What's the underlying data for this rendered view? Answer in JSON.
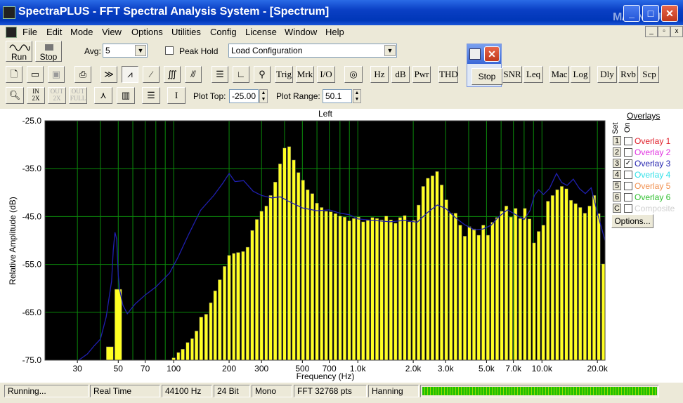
{
  "window": {
    "title": "SpectraPLUS - FFT Spectral Analysis System - [Spectrum]",
    "watermark": "MAGNITUDE"
  },
  "menu": [
    "File",
    "Edit",
    "Mode",
    "View",
    "Options",
    "Utilities",
    "Config",
    "License",
    "Window",
    "Help"
  ],
  "toolbar1": {
    "run_label": "Run",
    "stop_label": "Stop",
    "avg_label": "Avg:",
    "avg_value": "5",
    "peak_hold_label": "Peak Hold",
    "config_value": "Load Configuration"
  },
  "stop_popup": {
    "label": "Stop"
  },
  "toolbar2": {
    "text_buttons": [
      "Trig",
      "Mrk",
      "I/O",
      "Hz",
      "dB",
      "Pwr",
      "THD",
      "SNR",
      "Leq",
      "Mac",
      "Log",
      "Dly",
      "Rvb",
      "Scp"
    ]
  },
  "toolbar3": {
    "plot_top_label": "Plot Top:",
    "plot_top_value": "-25.00",
    "plot_range_label": "Plot Range:",
    "plot_range_value": "50.1"
  },
  "chart_data": {
    "type": "bar",
    "title": "Left",
    "xlabel": "Frequency (Hz)",
    "ylabel": "Relative Amplitude (dB)",
    "xscale": "log",
    "xlim": [
      20,
      22000
    ],
    "ylim": [
      -75,
      -25
    ],
    "yticks": [
      "-25.0",
      "-35.0",
      "-45.0",
      "-55.0",
      "-65.0",
      "-75.0"
    ],
    "xticks": [
      {
        "v": 30,
        "t": "30"
      },
      {
        "v": 50,
        "t": "50"
      },
      {
        "v": 70,
        "t": "70"
      },
      {
        "v": 100,
        "t": "100"
      },
      {
        "v": 200,
        "t": "200"
      },
      {
        "v": 300,
        "t": "300"
      },
      {
        "v": 500,
        "t": "500"
      },
      {
        "v": 700,
        "t": "700"
      },
      {
        "v": 1000,
        "t": "1.0k"
      },
      {
        "v": 2000,
        "t": "2.0k"
      },
      {
        "v": 3000,
        "t": "3.0k"
      },
      {
        "v": 5000,
        "t": "5.0k"
      },
      {
        "v": 7000,
        "t": "7.0k"
      },
      {
        "v": 10000,
        "t": "10.0k"
      },
      {
        "v": 20000,
        "t": "20.0k"
      }
    ],
    "grid": true,
    "bar_color": "#ffff22",
    "overlay_color": "#1f1fae",
    "bars": [
      {
        "f": 45,
        "db": -72.2
      },
      {
        "f": 50,
        "db": -60.2
      },
      {
        "f": 100,
        "db": -74.5
      },
      {
        "f": 106,
        "db": -73.4
      },
      {
        "f": 112,
        "db": -72.7
      },
      {
        "f": 119,
        "db": -71.3
      },
      {
        "f": 126,
        "db": -70.5
      },
      {
        "f": 133,
        "db": -68.9
      },
      {
        "f": 141,
        "db": -66.0
      },
      {
        "f": 150,
        "db": -65.4
      },
      {
        "f": 159,
        "db": -63.0
      },
      {
        "f": 168,
        "db": -60.5
      },
      {
        "f": 178,
        "db": -58.2
      },
      {
        "f": 189,
        "db": -55.4
      },
      {
        "f": 200,
        "db": -53.1
      },
      {
        "f": 212,
        "db": -52.7
      },
      {
        "f": 224,
        "db": -52.5
      },
      {
        "f": 238,
        "db": -52.3
      },
      {
        "f": 252,
        "db": -51.4
      },
      {
        "f": 267,
        "db": -47.9
      },
      {
        "f": 283,
        "db": -45.6
      },
      {
        "f": 300,
        "db": -43.9
      },
      {
        "f": 318,
        "db": -42.8
      },
      {
        "f": 336,
        "db": -40.6
      },
      {
        "f": 356,
        "db": -37.8
      },
      {
        "f": 378,
        "db": -34.0
      },
      {
        "f": 400,
        "db": -30.7
      },
      {
        "f": 424,
        "db": -30.4
      },
      {
        "f": 449,
        "db": -33.2
      },
      {
        "f": 476,
        "db": -35.8
      },
      {
        "f": 504,
        "db": -37.4
      },
      {
        "f": 534,
        "db": -39.4
      },
      {
        "f": 566,
        "db": -40.2
      },
      {
        "f": 600,
        "db": -42.2
      },
      {
        "f": 636,
        "db": -43.1
      },
      {
        "f": 673,
        "db": -43.9
      },
      {
        "f": 713,
        "db": -44.0
      },
      {
        "f": 756,
        "db": -44.4
      },
      {
        "f": 801,
        "db": -44.9
      },
      {
        "f": 848,
        "db": -45.1
      },
      {
        "f": 899,
        "db": -45.9
      },
      {
        "f": 952,
        "db": -45.4
      },
      {
        "f": 1009,
        "db": -45.1
      },
      {
        "f": 1069,
        "db": -46.1
      },
      {
        "f": 1133,
        "db": -45.8
      },
      {
        "f": 1200,
        "db": -45.2
      },
      {
        "f": 1271,
        "db": -45.4
      },
      {
        "f": 1347,
        "db": -45.7
      },
      {
        "f": 1427,
        "db": -44.9
      },
      {
        "f": 1512,
        "db": -45.7
      },
      {
        "f": 1602,
        "db": -46.4
      },
      {
        "f": 1697,
        "db": -45.2
      },
      {
        "f": 1798,
        "db": -44.8
      },
      {
        "f": 1905,
        "db": -46.1
      },
      {
        "f": 2018,
        "db": -45.8
      },
      {
        "f": 2138,
        "db": -42.6
      },
      {
        "f": 2265,
        "db": -38.7
      },
      {
        "f": 2400,
        "db": -37.0
      },
      {
        "f": 2543,
        "db": -36.5
      },
      {
        "f": 2694,
        "db": -35.6
      },
      {
        "f": 2854,
        "db": -38.4
      },
      {
        "f": 3024,
        "db": -41.5
      },
      {
        "f": 3204,
        "db": -44.3
      },
      {
        "f": 3394,
        "db": -44.3
      },
      {
        "f": 3596,
        "db": -46.8
      },
      {
        "f": 3810,
        "db": -49.1
      },
      {
        "f": 4036,
        "db": -47.1
      },
      {
        "f": 4276,
        "db": -47.6
      },
      {
        "f": 4531,
        "db": -48.9
      },
      {
        "f": 4800,
        "db": -46.8
      },
      {
        "f": 5085,
        "db": -48.9
      },
      {
        "f": 5388,
        "db": -46.2
      },
      {
        "f": 5708,
        "db": -45.2
      },
      {
        "f": 6047,
        "db": -43.9
      },
      {
        "f": 6407,
        "db": -42.8
      },
      {
        "f": 6788,
        "db": -45.1
      },
      {
        "f": 7191,
        "db": -43.3
      },
      {
        "f": 7619,
        "db": -45.4
      },
      {
        "f": 8072,
        "db": -43.3
      },
      {
        "f": 8552,
        "db": -45.5
      },
      {
        "f": 9060,
        "db": -50.5
      },
      {
        "f": 9599,
        "db": -48.1
      },
      {
        "f": 10170,
        "db": -46.8
      },
      {
        "f": 10774,
        "db": -41.8
      },
      {
        "f": 11415,
        "db": -40.6
      },
      {
        "f": 12094,
        "db": -39.4
      },
      {
        "f": 12813,
        "db": -38.7
      },
      {
        "f": 13575,
        "db": -39.2
      },
      {
        "f": 14382,
        "db": -41.6
      },
      {
        "f": 15237,
        "db": -42.3
      },
      {
        "f": 16143,
        "db": -43.1
      },
      {
        "f": 17103,
        "db": -44.3
      },
      {
        "f": 18120,
        "db": -42.8
      },
      {
        "f": 19197,
        "db": -40.6
      },
      {
        "f": 20339,
        "db": -44.4
      },
      {
        "f": 21548,
        "db": -54.9
      }
    ],
    "overlay": [
      {
        "f": 20,
        "db": -76.5
      },
      {
        "f": 30,
        "db": -75.2
      },
      {
        "f": 34,
        "db": -73.7
      },
      {
        "f": 37,
        "db": -72.0
      },
      {
        "f": 40,
        "db": -70.6
      },
      {
        "f": 43,
        "db": -66.0
      },
      {
        "f": 46,
        "db": -58.5
      },
      {
        "f": 47,
        "db": -52.0
      },
      {
        "f": 48,
        "db": -48.3
      },
      {
        "f": 49,
        "db": -49.7
      },
      {
        "f": 50,
        "db": -57.2
      },
      {
        "f": 51,
        "db": -60.4
      },
      {
        "f": 53,
        "db": -63.5
      },
      {
        "f": 56,
        "db": -65.3
      },
      {
        "f": 62,
        "db": -63.2
      },
      {
        "f": 70,
        "db": -61.4
      },
      {
        "f": 80,
        "db": -59.7
      },
      {
        "f": 95,
        "db": -56.8
      },
      {
        "f": 105,
        "db": -53.7
      },
      {
        "f": 120,
        "db": -48.9
      },
      {
        "f": 140,
        "db": -43.7
      },
      {
        "f": 165,
        "db": -40.6
      },
      {
        "f": 185,
        "db": -38.0
      },
      {
        "f": 200,
        "db": -36.0
      },
      {
        "f": 215,
        "db": -37.7
      },
      {
        "f": 240,
        "db": -37.5
      },
      {
        "f": 270,
        "db": -39.7
      },
      {
        "f": 300,
        "db": -40.6
      },
      {
        "f": 340,
        "db": -41.1
      },
      {
        "f": 380,
        "db": -40.9
      },
      {
        "f": 420,
        "db": -41.8
      },
      {
        "f": 500,
        "db": -43.2
      },
      {
        "f": 600,
        "db": -43.8
      },
      {
        "f": 700,
        "db": -43.6
      },
      {
        "f": 800,
        "db": -44.3
      },
      {
        "f": 900,
        "db": -44.6
      },
      {
        "f": 1000,
        "db": -45.5
      },
      {
        "f": 1200,
        "db": -45.8
      },
      {
        "f": 1500,
        "db": -46.1
      },
      {
        "f": 1800,
        "db": -45.8
      },
      {
        "f": 2100,
        "db": -46.2
      },
      {
        "f": 2400,
        "db": -44.1
      },
      {
        "f": 2700,
        "db": -42.6
      },
      {
        "f": 3000,
        "db": -43.3
      },
      {
        "f": 3400,
        "db": -45.3
      },
      {
        "f": 3800,
        "db": -46.7
      },
      {
        "f": 4300,
        "db": -47.8
      },
      {
        "f": 4800,
        "db": -47.6
      },
      {
        "f": 5300,
        "db": -46.8
      },
      {
        "f": 5800,
        "db": -45.1
      },
      {
        "f": 6500,
        "db": -43.6
      },
      {
        "f": 7200,
        "db": -44.6
      },
      {
        "f": 8000,
        "db": -45.6
      },
      {
        "f": 8600,
        "db": -43.8
      },
      {
        "f": 9100,
        "db": -40.6
      },
      {
        "f": 9600,
        "db": -39.4
      },
      {
        "f": 10200,
        "db": -40.4
      },
      {
        "f": 11000,
        "db": -39.1
      },
      {
        "f": 12000,
        "db": -36.0
      },
      {
        "f": 12800,
        "db": -37.9
      },
      {
        "f": 13700,
        "db": -38.5
      },
      {
        "f": 14800,
        "db": -37.2
      },
      {
        "f": 16000,
        "db": -39.2
      },
      {
        "f": 17200,
        "db": -40.2
      },
      {
        "f": 18500,
        "db": -39.0
      },
      {
        "f": 20000,
        "db": -44.3
      },
      {
        "f": 22000,
        "db": -50.0
      }
    ]
  },
  "overlays_panel": {
    "title": "Overlays",
    "set_header": "Set",
    "on_header": "On",
    "items": [
      {
        "set": "1",
        "label": "Overlay 1",
        "color": "#e0202a",
        "checked": false
      },
      {
        "set": "2",
        "label": "Overlay 2",
        "color": "#e030e0",
        "checked": false
      },
      {
        "set": "3",
        "label": "Overlay 3",
        "color": "#1f1fae",
        "checked": true
      },
      {
        "set": "4",
        "label": "Overlay 4",
        "color": "#30e0e8",
        "checked": false
      },
      {
        "set": "5",
        "label": "Overlay 5",
        "color": "#f09050",
        "checked": false
      },
      {
        "set": "6",
        "label": "Overlay 6",
        "color": "#30c030",
        "checked": false
      },
      {
        "set": "C",
        "label": "Composite",
        "color": "#d0d0d0",
        "checked": false
      }
    ],
    "options_label": "Options..."
  },
  "statusbar": {
    "state": "Running...",
    "mode": "Real Time",
    "rate": "44100 Hz",
    "bits": "24 Bit",
    "channels": "Mono",
    "fft": "FFT 32768 pts",
    "window": "Hanning",
    "level_fraction": 1.0
  }
}
